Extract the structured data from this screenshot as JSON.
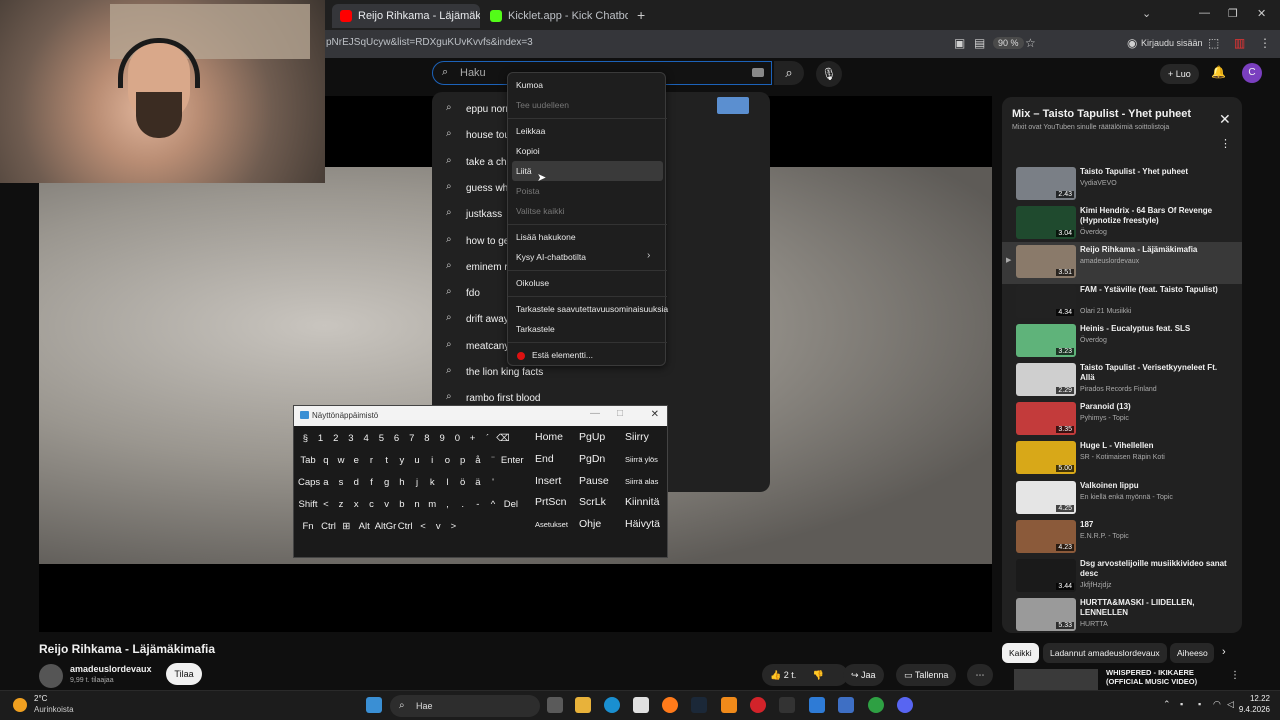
{
  "browser": {
    "tabs": [
      {
        "label": "Reijo Rihkama - Läjämäkimafia",
        "active": true
      },
      {
        "label": "Kicklet.app - Kick Chatbot and C",
        "active": false
      }
    ],
    "url": "pNrEJSqUcyw&list=RDXguKUvKvvfs&index=3",
    "zoom": "90 %",
    "login": "Kirjaudu sisään"
  },
  "youtube": {
    "search_placeholder": "Haku",
    "create_label": "Luo",
    "avatar_letter": "C"
  },
  "suggestions": [
    "eppu normaali",
    "house tou",
    "take a ch",
    "guess wh",
    "justkass",
    "how to ge",
    "eminem r",
    "fdo",
    "drift away",
    "meatcany",
    "the lion king facts",
    "rambo first blood"
  ],
  "context_menu": {
    "items": [
      {
        "label": "Kumoa",
        "disabled": false
      },
      {
        "label": "Tee uudelleen",
        "disabled": true
      },
      {
        "label": "Leikkaa",
        "disabled": false
      },
      {
        "label": "Kopioi",
        "disabled": false
      },
      {
        "label": "Liitä",
        "disabled": false
      },
      {
        "label": "Poista",
        "disabled": true
      },
      {
        "label": "Valitse kaikki",
        "disabled": true
      },
      {
        "label": "Lisää hakukone",
        "disabled": false
      },
      {
        "label": "Kysy AI-chatbotilta",
        "disabled": false
      },
      {
        "label": "Oikoluse",
        "disabled": false
      },
      {
        "label": "Tarkastele saavutettavuusominaisuuksia",
        "disabled": false
      },
      {
        "label": "Tarkastele",
        "disabled": false
      },
      {
        "label": "Estä elementti...",
        "disabled": false
      }
    ]
  },
  "keyboard": {
    "title": "Näyttönäppäimistö",
    "row1": [
      "§",
      "1",
      "2",
      "3",
      "4",
      "5",
      "6",
      "7",
      "8",
      "9",
      "0",
      "+",
      "´",
      "⌫"
    ],
    "row2": [
      "Tab",
      "q",
      "w",
      "e",
      "r",
      "t",
      "y",
      "u",
      "i",
      "o",
      "p",
      "å",
      "¨",
      "Enter"
    ],
    "row3": [
      "Caps",
      "a",
      "s",
      "d",
      "f",
      "g",
      "h",
      "j",
      "k",
      "l",
      "ö",
      "ä",
      "'"
    ],
    "row4": [
      "Shift",
      "<",
      "z",
      "x",
      "c",
      "v",
      "b",
      "n",
      "m",
      ",",
      ".",
      "-",
      "^",
      "Del"
    ],
    "row5": [
      "Fn",
      "Ctrl",
      "⊞",
      "Alt",
      "AltGr",
      "Ctrl",
      "<",
      "v",
      ">"
    ],
    "nav": [
      [
        "Home",
        "PgUp",
        "Siirry"
      ],
      [
        "End",
        "PgDn",
        "Siirrä ylös"
      ],
      [
        "Insert",
        "Pause",
        "Siirrä alas"
      ],
      [
        "PrtScn",
        "ScrLk",
        "Kiinnitä"
      ],
      [
        "Asetukset",
        "Ohje",
        "Häivytä"
      ]
    ]
  },
  "playlist": {
    "title": "Mix – Taisto Tapulist - Yhet puheet",
    "subtitle": "Mixit ovat YouTuben sinulle räätälöimiä soittolistoja",
    "items": [
      {
        "title": "Taisto Tapulist - Yhet puheet",
        "channel": "VydiaVEVO",
        "duration": "2.43",
        "color": "#7a7f86"
      },
      {
        "title": "Kimi Hendrix - 64 Bars Of Revenge (Hypnotize freestyle)",
        "channel": "Överdog",
        "duration": "3.04",
        "color": "#1f4a2e"
      },
      {
        "title": "Reijo Rihkama - Läjämäkimafia",
        "channel": "amadeuslordevaux",
        "duration": "3.51",
        "color": "#8a7a6a",
        "current": true
      },
      {
        "title": "FAM - Ystäville (feat. Taisto Tapulist)",
        "channel": "Olari 21 Musiikki",
        "duration": "4.34",
        "color": "#222222"
      },
      {
        "title": "Heinis - Eucalyptus feat. SLS",
        "channel": "Överdog",
        "duration": "3.23",
        "color": "#5fb37a"
      },
      {
        "title": "Taisto Tapulist - Verisetkyyneleet Ft. Allä",
        "channel": "Pirados Records Finland",
        "duration": "2.29",
        "color": "#cfcfcf"
      },
      {
        "title": "Paranoid (13)",
        "channel": "Pyhimys - Topic",
        "duration": "3.35",
        "color": "#c33b3b"
      },
      {
        "title": "Huge L - Vihellellen",
        "channel": "SR - Kotimaisen Räpin Koti",
        "duration": "5.00",
        "color": "#d8a818"
      },
      {
        "title": "Valkoinen lippu",
        "channel": "En kiellä enkä myönnä - Topic",
        "duration": "4.25",
        "color": "#e5e5e5"
      },
      {
        "title": "187",
        "channel": "E.N.R.P. - Topic",
        "duration": "4.23",
        "color": "#8b5a3a"
      },
      {
        "title": "Dsg arvostelijoille musiikkivideo sanat desc",
        "channel": "JkfjfHzjdjz",
        "duration": "3.44",
        "color": "#1a1a1a"
      },
      {
        "title": "HURTTA&MASKI - LIIDELLEN, LENNELLEN",
        "channel": "HURTTA",
        "duration": "5.33",
        "color": "#9a9a9a"
      }
    ]
  },
  "video": {
    "title": "Reijo Rihkama - Läjämäkimafia",
    "channel": "amadeuslordevaux",
    "subscribers": "9,99 t. tilaajaa",
    "subscribe_label": "Tilaa",
    "likes": "2 t.",
    "share_label": "Jaa",
    "save_label": "Tallenna"
  },
  "chips": [
    "Kaikki",
    "Ladannut amadeuslordevaux",
    "Aiheeso"
  ],
  "next_video": "WHISPERED - IKIKAERE (OFFICIAL MUSIC VIDEO)",
  "taskbar": {
    "weather_temp": "2°C",
    "weather_desc": "Aurinkoista",
    "search": "Hae",
    "time": "12.22",
    "date": "9.4.2026"
  }
}
